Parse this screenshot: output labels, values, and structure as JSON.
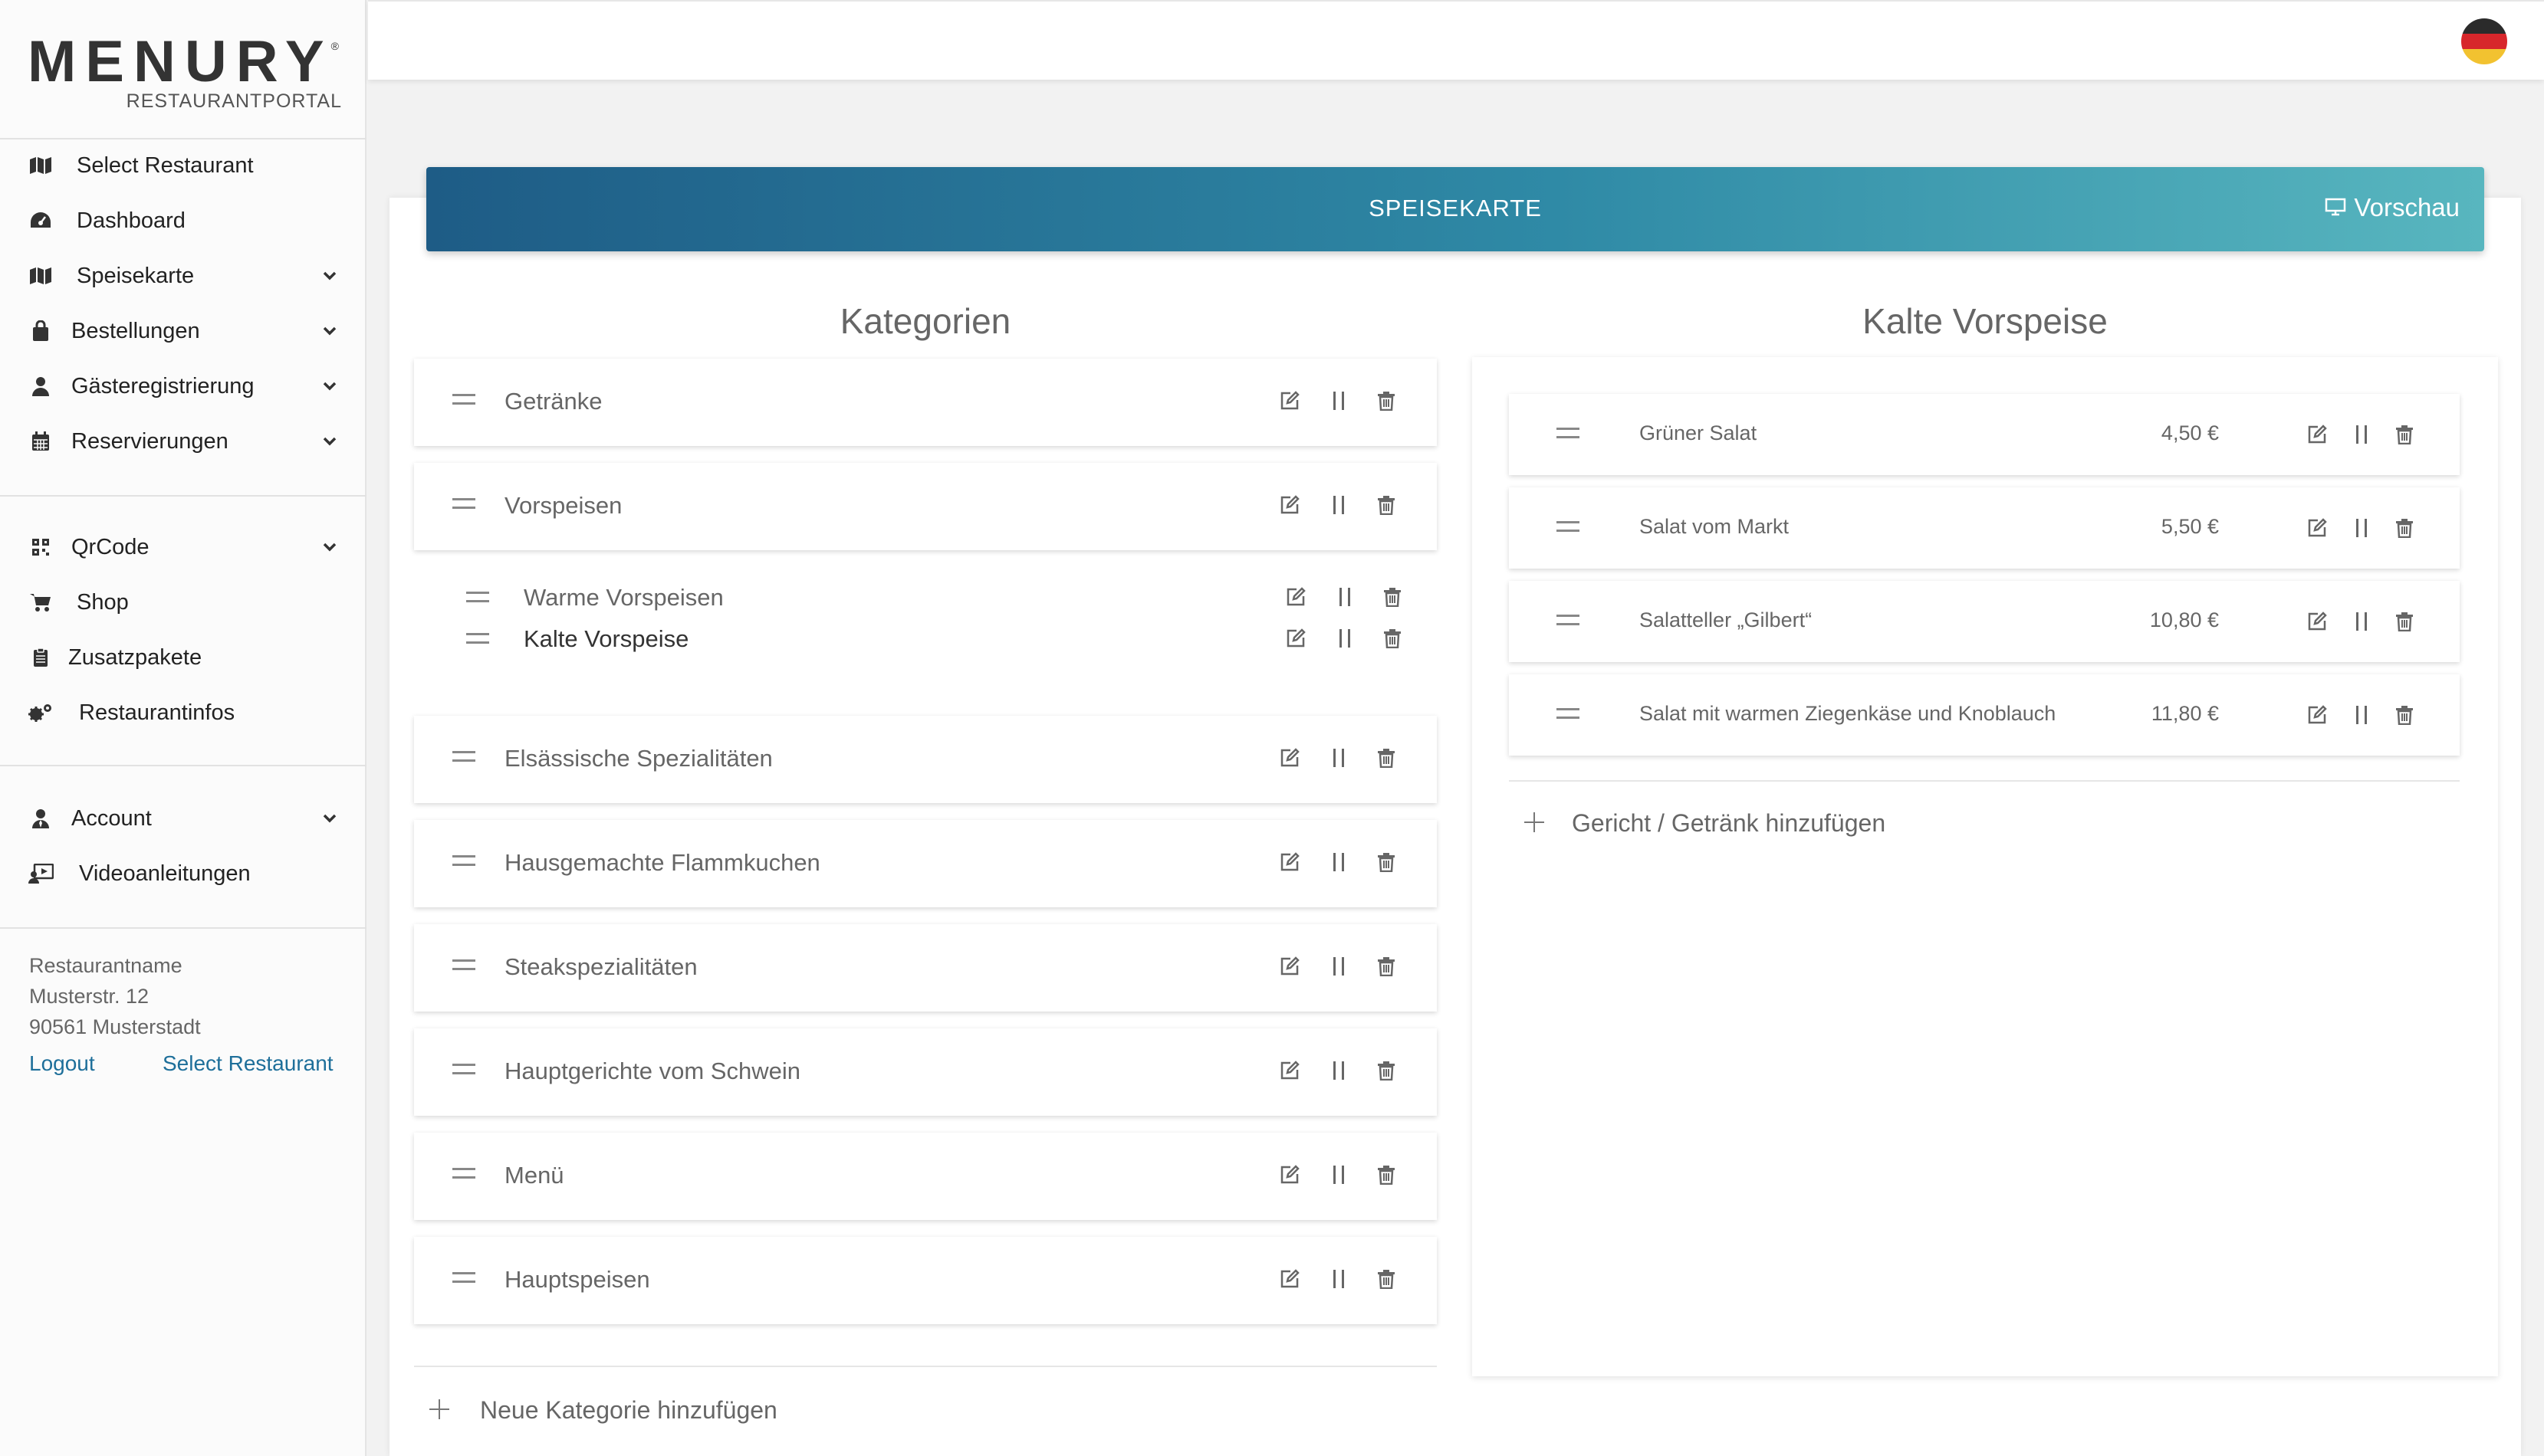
{
  "brand": {
    "name": "MENURY",
    "reg": "®",
    "subtitle": "RESTAURANTPORTAL"
  },
  "sidebar": {
    "items": [
      {
        "label": "Select Restaurant",
        "icon": "map-icon"
      },
      {
        "label": "Dashboard",
        "icon": "dashboard-icon"
      },
      {
        "label": "Speisekarte",
        "icon": "map-icon",
        "chevron": true
      },
      {
        "label": "Bestellungen",
        "icon": "bag-icon",
        "chevron": true
      },
      {
        "label": "Gästeregistrierung",
        "icon": "user-icon",
        "chevron": true
      },
      {
        "label": "Reservierungen",
        "icon": "calendar-icon",
        "chevron": true
      },
      {
        "label": "QrCode",
        "icon": "qrcode-icon",
        "chevron": true
      },
      {
        "label": "Shop",
        "icon": "cart-icon"
      },
      {
        "label": "Zusatzpakete",
        "icon": "clipboard-icon"
      },
      {
        "label": "Restaurantinfos",
        "icon": "gears-icon"
      },
      {
        "label": "Account",
        "icon": "user-tie-icon",
        "chevron": true
      },
      {
        "label": "Videoanleitungen",
        "icon": "video-icon"
      }
    ],
    "restaurant": {
      "name": "Restaurantname",
      "street": "Musterstr. 12",
      "city": "90561 Musterstadt"
    },
    "logout": "Logout",
    "select_restaurant": "Select Restaurant"
  },
  "topbar": {
    "language_icon": "german-flag-icon"
  },
  "header": {
    "title": "SPEISEKARTE",
    "preview": "Vorschau",
    "preview_icon": "monitor-icon"
  },
  "categories": {
    "title": "Kategorien",
    "items": [
      {
        "label": "Getränke"
      },
      {
        "label": "Vorspeisen",
        "children": [
          "Warme Vorspeisen",
          "Kalte Vorspeise"
        ]
      },
      {
        "label": "Elsässische Spezialitäten"
      },
      {
        "label": "Hausgemachte Flammkuchen"
      },
      {
        "label": "Steakspezialitäten"
      },
      {
        "label": "Hauptgerichte vom Schwein"
      },
      {
        "label": "Menü"
      },
      {
        "label": "Hauptspeisen"
      }
    ],
    "add_label": "Neue Kategorie hinzufügen"
  },
  "dishes": {
    "title": "Kalte Vorspeise",
    "items": [
      {
        "name": "Grüner Salat",
        "price": "4,50 €"
      },
      {
        "name": "Salat vom Markt",
        "price": "5,50 €"
      },
      {
        "name": "Salatteller „Gilbert“",
        "price": "10,80 €"
      },
      {
        "name": "Salat mit warmen Ziegenkäse und Knoblauch",
        "price": "11,80 €"
      }
    ],
    "add_label": "Gericht / Getränk hinzufügen"
  },
  "colors": {
    "accent_start": "#1e5c86",
    "accent_end": "#58b6bf",
    "link": "#1e6f9a"
  }
}
